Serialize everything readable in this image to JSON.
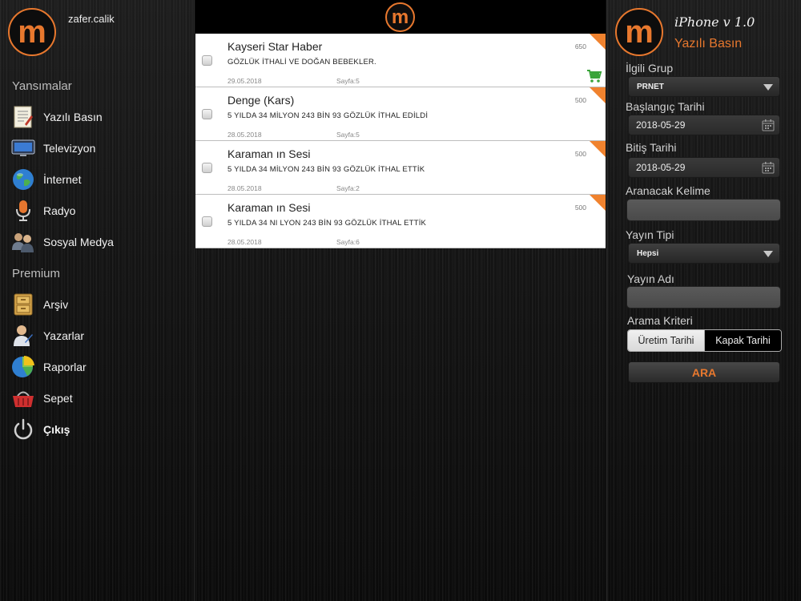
{
  "sidebar": {
    "logo_letter": "m",
    "username": "zafer.calik",
    "section_yansimalar": "Yansımalar",
    "section_premium": "Premium",
    "items": [
      {
        "label": "Yazılı Basın",
        "icon": "newspaper-icon"
      },
      {
        "label": "Televizyon",
        "icon": "tv-icon"
      },
      {
        "label": "İnternet",
        "icon": "globe-icon"
      },
      {
        "label": "Radyo",
        "icon": "microphone-icon"
      },
      {
        "label": "Sosyal Medya",
        "icon": "people-icon"
      }
    ],
    "premium_items": [
      {
        "label": "Arşiv",
        "icon": "cabinet-icon"
      },
      {
        "label": "Yazarlar",
        "icon": "writer-icon"
      },
      {
        "label": "Raporlar",
        "icon": "pie-chart-icon"
      },
      {
        "label": "Sepet",
        "icon": "basket-icon"
      },
      {
        "label": "Çıkış",
        "icon": "power-icon"
      }
    ]
  },
  "center": {
    "logo_letter": "m",
    "results": [
      {
        "title": "Kayseri Star Haber",
        "subtitle": "GÖZLÜK İTHALİ VE DOĞAN BEBEKLER.",
        "date": "29.05.2018",
        "page": "Sayfa:5",
        "count": "650",
        "in_cart": true
      },
      {
        "title": "Denge (Kars)",
        "subtitle": "5 YILDA 34 MİLYON 243 BİN 93 GÖZLÜK İTHAL EDİLDİ",
        "date": "28.05.2018",
        "page": "Sayfa:5",
        "count": "500",
        "in_cart": false
      },
      {
        "title": "Karaman ın Sesi",
        "subtitle": "5 YILDA 34 MİLYON 243 BİN 93 GÖZLÜK İTHAL ETTİK",
        "date": "28.05.2018",
        "page": "Sayfa:2",
        "count": "500",
        "in_cart": false
      },
      {
        "title": "Karaman ın Sesi",
        "subtitle": "5 YILDA 34 NI LYON 243 BİN 93 GÖZLÜK İTHAL ETTİK",
        "date": "28.05.2018",
        "page": "Sayfa:6",
        "count": "500",
        "in_cart": false
      }
    ]
  },
  "panel": {
    "logo_letter": "m",
    "app_version": "iPhone v 1.0",
    "title": "Yazılı Basın",
    "ilgili_grup_label": "İlgili Grup",
    "ilgili_grup_value": "PRNET",
    "baslangic_label": "Başlangıç Tarihi",
    "baslangic_value": "2018-05-29",
    "bitis_label": "Bitiş Tarihi",
    "bitis_value": "2018-05-29",
    "aranacak_label": "Aranacak Kelime",
    "aranacak_value": "",
    "yayin_tipi_label": "Yayın Tipi",
    "yayin_tipi_value": "Hepsi",
    "yayin_adi_label": "Yayın Adı",
    "yayin_adi_value": "",
    "arama_kriteri_label": "Arama Kriteri",
    "segments": [
      "Üretim Tarihi",
      "Kapak Tarihi"
    ],
    "selected_segment": "Üretim Tarihi",
    "search_button": "ARA"
  },
  "colors": {
    "accent": "#e8782e",
    "background": "#111111"
  }
}
